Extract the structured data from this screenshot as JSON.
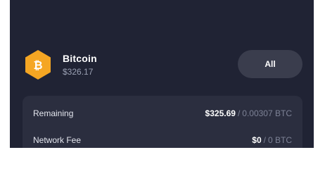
{
  "asset": {
    "name": "Bitcoin",
    "value": "$326.17",
    "icon": "bitcoin-icon",
    "icon_color": "#F5A623",
    "all_button_label": "All"
  },
  "summary": {
    "remaining": {
      "label": "Remaining",
      "usd": "$325.69",
      "separator": "/",
      "btc": "0.00307 BTC"
    },
    "network_fee": {
      "label": "Network Fee",
      "usd": "$0",
      "separator": "/",
      "btc": "0 BTC"
    }
  },
  "colors": {
    "background": "#202334",
    "card": "#2B2E3F",
    "button": "#3A3D4D",
    "muted_text": "#7D8296"
  }
}
